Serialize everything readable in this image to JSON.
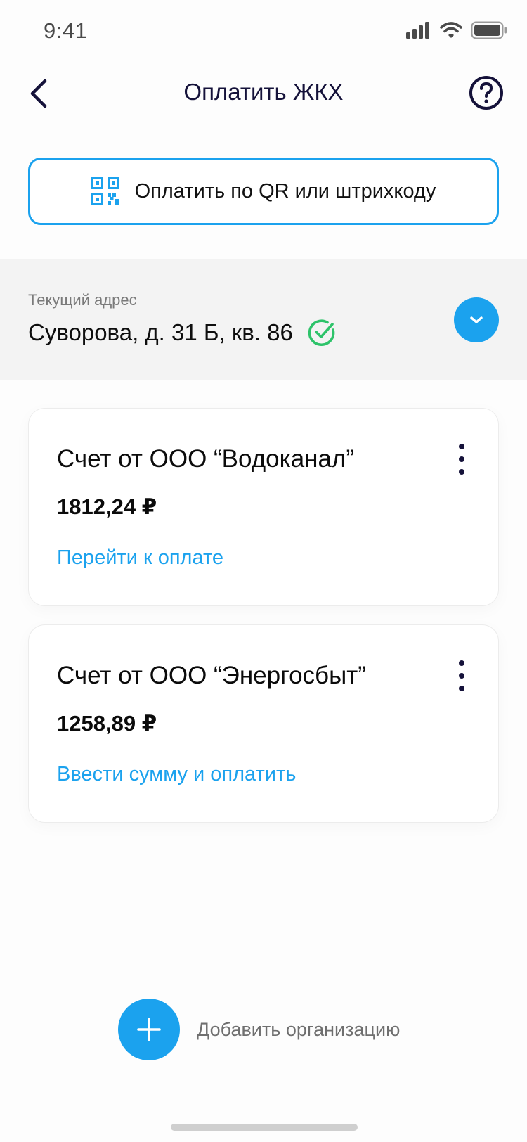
{
  "status_bar": {
    "time": "9:41"
  },
  "header": {
    "title": "Оплатить ЖКХ"
  },
  "qr_button": {
    "label": "Оплатить по QR или штрихкоду"
  },
  "address": {
    "caption": "Текущий адрес",
    "value": "Суворова, д. 31 Б, кв. 86"
  },
  "bills": [
    {
      "title": "Счет от ООО “Водоканал”",
      "amount": "1812,24 ₽",
      "action": "Перейти к оплате"
    },
    {
      "title": "Счет от ООО “Энергосбыт”",
      "amount": "1258,89 ₽",
      "action": "Ввести сумму и оплатить"
    }
  ],
  "add_org": {
    "label": "Добавить организацию"
  },
  "colors": {
    "accent": "#1ba2ee",
    "title_dark": "#15123a",
    "check_green": "#2ec36a",
    "panel_bg": "#f3f3f3"
  },
  "icons": {
    "back": "chevron-left-icon",
    "help": "question-circle-icon",
    "qr": "qr-code-icon",
    "verified": "check-circle-icon",
    "expand": "chevron-down-icon",
    "more": "more-vertical-icon",
    "add": "plus-icon"
  }
}
